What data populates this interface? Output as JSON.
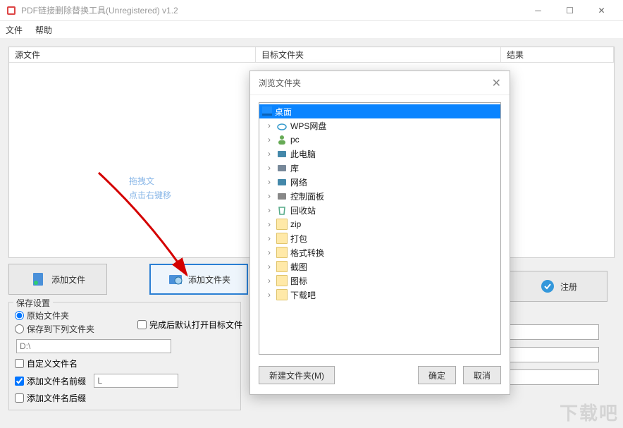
{
  "window": {
    "title": "PDF链接删除替换工具(Unregistered) v1.2"
  },
  "menu": {
    "file": "文件",
    "help": "帮助"
  },
  "columns": {
    "source": "源文件",
    "target": "目标文件夹",
    "result": "结果"
  },
  "hint": {
    "line1": "拖拽文",
    "line2": "点击右键移"
  },
  "buttons": {
    "add_file": "添加文件",
    "add_folder": "添加文件夹",
    "register": "注册",
    "new_folder": "新建文件夹(M)",
    "ok": "确定",
    "cancel": "取消"
  },
  "save": {
    "legend": "保存设置",
    "original_folder": "原始文件夹",
    "save_to_folder": "保存到下列文件夹",
    "path": "D:\\",
    "custom_name": "自定义文件名",
    "prefix": "添加文件名前缀",
    "prefix_value": "L",
    "suffix": "添加文件名后缀",
    "open_after": "完成后默认打开目标文件"
  },
  "dialog": {
    "title": "浏览文件夹",
    "root": "桌面",
    "items": [
      {
        "label": "WPS网盘",
        "icon": "cloud"
      },
      {
        "label": "pc",
        "icon": "user"
      },
      {
        "label": "此电脑",
        "icon": "pc"
      },
      {
        "label": "库",
        "icon": "library"
      },
      {
        "label": "网络",
        "icon": "network"
      },
      {
        "label": "控制面板",
        "icon": "control"
      },
      {
        "label": "回收站",
        "icon": "recycle"
      },
      {
        "label": "zip",
        "icon": "folder"
      },
      {
        "label": "打包",
        "icon": "folder"
      },
      {
        "label": "格式转换",
        "icon": "folder"
      },
      {
        "label": "截图",
        "icon": "folder"
      },
      {
        "label": "图标",
        "icon": "folder"
      },
      {
        "label": "下载吧",
        "icon": "folder"
      }
    ]
  },
  "watermark": "下载吧"
}
